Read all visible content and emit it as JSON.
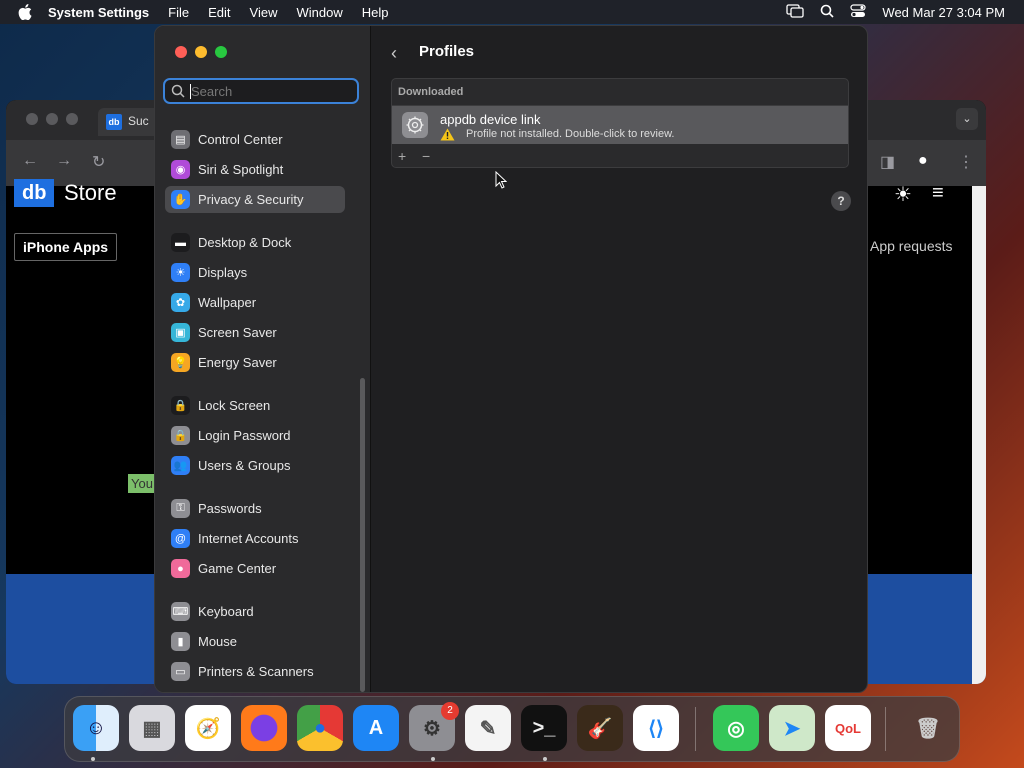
{
  "menubar": {
    "app_name": "System Settings",
    "menus": [
      "File",
      "Edit",
      "View",
      "Window",
      "Help"
    ],
    "clock": "Wed Mar 27  3:04 PM"
  },
  "browser": {
    "tab_favicon": "db",
    "tab_title": "Suc",
    "logo": "db",
    "store": "Store",
    "iphone_apps": "iPhone Apps",
    "app_requests": "App requests",
    "you": "You"
  },
  "settings": {
    "search_placeholder": "Search",
    "sidebar": [
      {
        "label": "Control Center",
        "icon": "control-center-icon",
        "color": "#6e6e73"
      },
      {
        "label": "Siri & Spotlight",
        "icon": "siri-icon",
        "color": "#b04bd8"
      },
      {
        "label": "Privacy & Security",
        "icon": "hand-icon",
        "color": "#2f7ff6",
        "active": true
      },
      {
        "label": "Desktop & Dock",
        "icon": "dock-icon",
        "color": "#1c1c1e"
      },
      {
        "label": "Displays",
        "icon": "sun-icon",
        "color": "#2f7ff6"
      },
      {
        "label": "Wallpaper",
        "icon": "flower-icon",
        "color": "#36a9e8"
      },
      {
        "label": "Screen Saver",
        "icon": "screensaver-icon",
        "color": "#36b6d8"
      },
      {
        "label": "Energy Saver",
        "icon": "lightbulb-icon",
        "color": "#f5a623"
      },
      {
        "label": "Lock Screen",
        "icon": "lock-icon",
        "color": "#1c1c1e"
      },
      {
        "label": "Login Password",
        "icon": "lock-icon",
        "color": "#8e8e93"
      },
      {
        "label": "Users & Groups",
        "icon": "users-icon",
        "color": "#2f7ff6"
      },
      {
        "label": "Passwords",
        "icon": "key-icon",
        "color": "#8e8e93"
      },
      {
        "label": "Internet Accounts",
        "icon": "at-icon",
        "color": "#2f7ff6"
      },
      {
        "label": "Game Center",
        "icon": "game-center-icon",
        "color": "#f06a9a"
      },
      {
        "label": "Keyboard",
        "icon": "keyboard-icon",
        "color": "#8e8e93"
      },
      {
        "label": "Mouse",
        "icon": "mouse-icon",
        "color": "#8e8e93"
      },
      {
        "label": "Printers & Scanners",
        "icon": "printer-icon",
        "color": "#8e8e93"
      }
    ],
    "main": {
      "title": "Profiles",
      "section": "Downloaded",
      "profile_name": "appdb device link",
      "profile_status": "Profile not installed. Double-click to review.",
      "add": "+",
      "remove": "−",
      "help": "?"
    }
  },
  "dock": {
    "badge": "2",
    "apps": [
      {
        "name": "finder-icon"
      },
      {
        "name": "launchpad-icon"
      },
      {
        "name": "safari-icon"
      },
      {
        "name": "firefox-icon"
      },
      {
        "name": "chrome-icon"
      },
      {
        "name": "app-store-icon"
      },
      {
        "name": "system-settings-icon"
      },
      {
        "name": "textedit-icon"
      },
      {
        "name": "terminal-icon"
      },
      {
        "name": "garageband-icon"
      },
      {
        "name": "vscode-icon"
      },
      {
        "name": "find-my-icon"
      },
      {
        "name": "maps-icon"
      },
      {
        "name": "qol-icon"
      },
      {
        "name": "trash-icon"
      }
    ]
  }
}
